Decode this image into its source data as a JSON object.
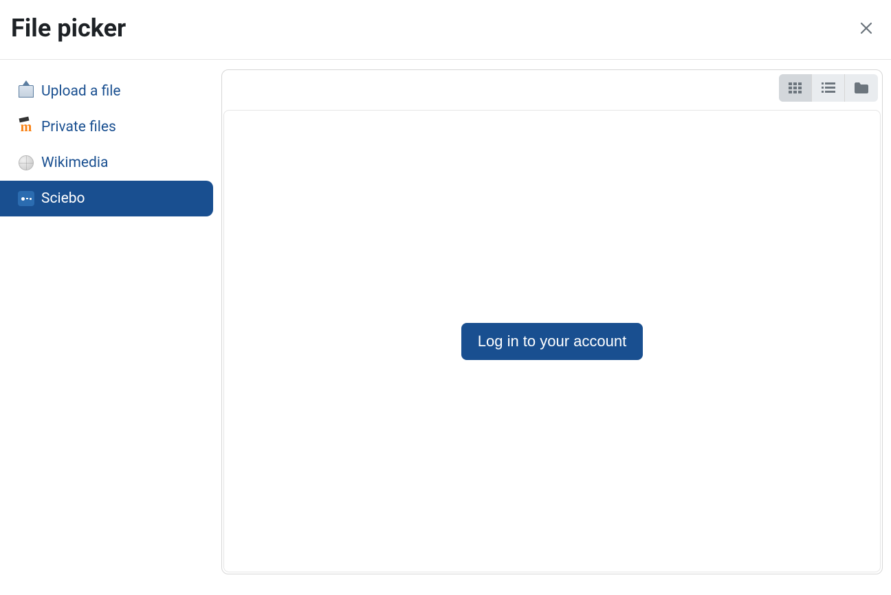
{
  "header": {
    "title": "File picker"
  },
  "sidebar": {
    "items": [
      {
        "id": "upload",
        "label": "Upload a file"
      },
      {
        "id": "private",
        "label": "Private files"
      },
      {
        "id": "wikimedia",
        "label": "Wikimedia"
      },
      {
        "id": "sciebo",
        "label": "Sciebo"
      }
    ],
    "active": "sciebo"
  },
  "main": {
    "login_button": "Log in to your account"
  }
}
